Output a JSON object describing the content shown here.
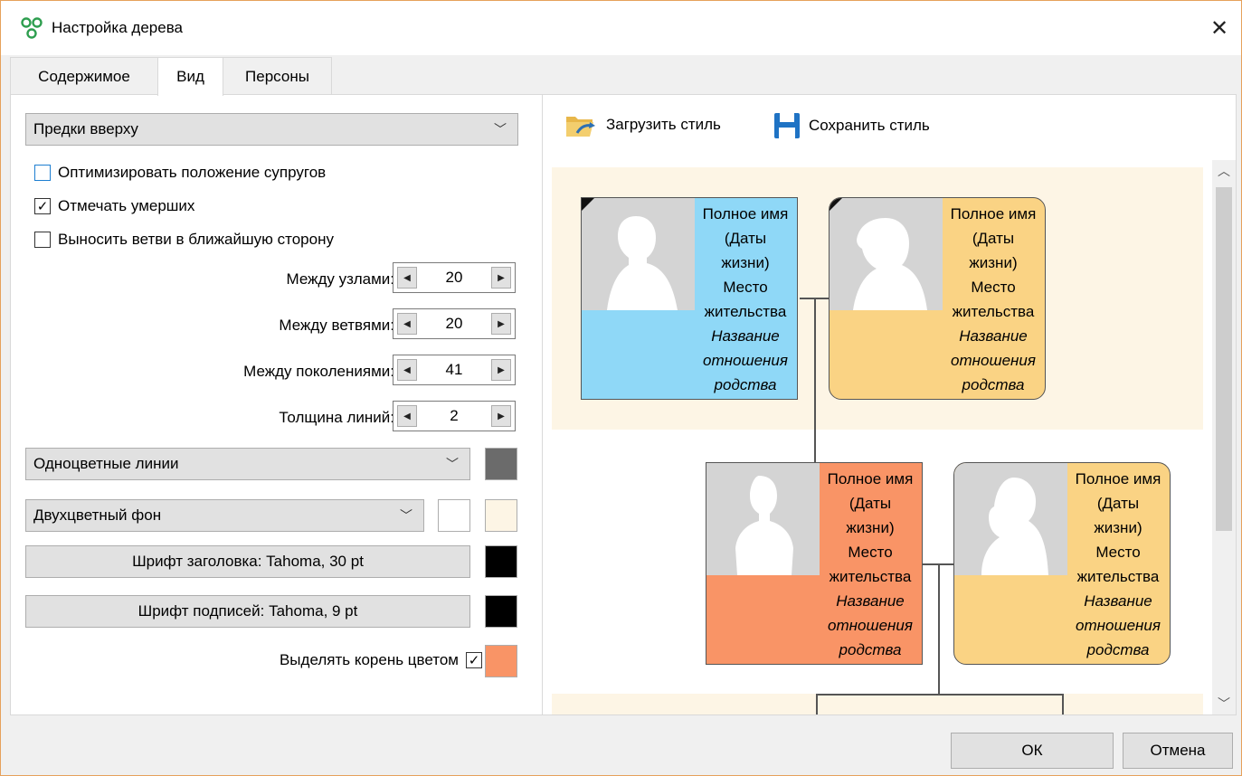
{
  "window": {
    "title": "Настройка дерева",
    "close_glyph": "✕"
  },
  "tabs": [
    {
      "label": "Содержимое",
      "active": false
    },
    {
      "label": "Вид",
      "active": true
    },
    {
      "label": "Персоны",
      "active": false
    }
  ],
  "layout_options": {
    "orientation": {
      "value": "Предки вверху"
    },
    "checkboxes": [
      {
        "label": "Оптимизировать положение супругов",
        "checked": false
      },
      {
        "label": "Отмечать умерших",
        "checked": true
      },
      {
        "label": "Выносить ветви в ближайшую сторону",
        "checked": false
      }
    ],
    "spinners": [
      {
        "label": "Между узлами:",
        "value": "20"
      },
      {
        "label": "Между ветвями:",
        "value": "20"
      },
      {
        "label": "Между поколениями:",
        "value": "41"
      },
      {
        "label": "Толщина линий:",
        "value": "2"
      }
    ],
    "lines_mode": {
      "value": "Одноцветные линии",
      "color": "#6b6b6b"
    },
    "background_mode": {
      "value": "Двухцветный фон",
      "color1": "#ffffff",
      "color2": "#fdf5e5"
    },
    "title_font_button": {
      "label": "Шрифт заголовка: Tahoma, 30 pt",
      "color": "#000000"
    },
    "caption_font_button": {
      "label": "Шрифт подписей: Tahoma, 9 pt",
      "color": "#000000"
    },
    "highlight_root": {
      "label": "Выделять корень цветом",
      "checked": true,
      "color": "#f99466"
    }
  },
  "toolbar": {
    "load_style": "Загрузить стиль",
    "save_style": "Сохранить стиль"
  },
  "preview": {
    "card_lines": [
      "Полное имя",
      "(Даты",
      "жизни)",
      "Место",
      "жительства"
    ],
    "card_relation": [
      "Название",
      "отношения",
      "родства"
    ],
    "colors": {
      "male": "#8fd8f7",
      "female": "#fad384",
      "root": "#f99466",
      "band": "#fdf5e5",
      "photo": "#d4d4d4"
    }
  },
  "footer": {
    "ok": "ОК",
    "cancel": "Отмена"
  }
}
